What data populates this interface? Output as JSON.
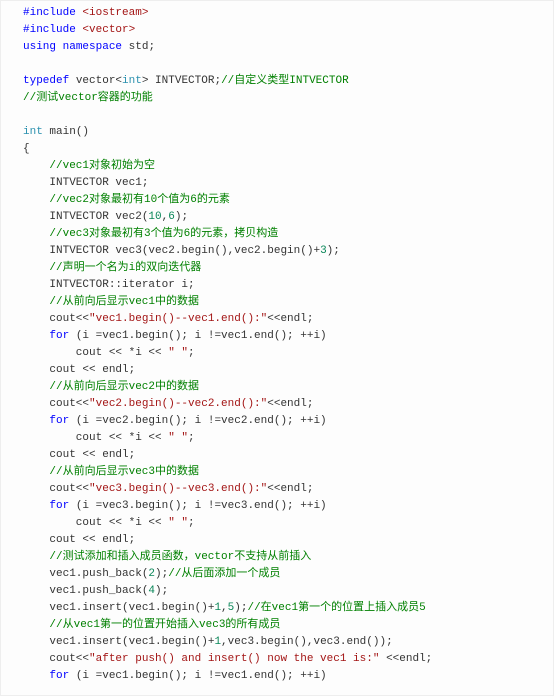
{
  "code": {
    "lines": [
      [
        {
          "c": "kw",
          "t": "#include"
        },
        {
          "c": "",
          "t": " "
        },
        {
          "c": "str",
          "t": "<iostream>"
        }
      ],
      [
        {
          "c": "kw",
          "t": "#include"
        },
        {
          "c": "",
          "t": " "
        },
        {
          "c": "str",
          "t": "<vector>"
        }
      ],
      [
        {
          "c": "kw",
          "t": "using"
        },
        {
          "c": "",
          "t": " "
        },
        {
          "c": "kw",
          "t": "namespace"
        },
        {
          "c": "",
          "t": " std;"
        }
      ],
      [
        {
          "c": "",
          "t": ""
        }
      ],
      [
        {
          "c": "kw",
          "t": "typedef"
        },
        {
          "c": "",
          "t": " vector<"
        },
        {
          "c": "type",
          "t": "int"
        },
        {
          "c": "",
          "t": "> INTVECTOR;"
        },
        {
          "c": "cmt",
          "t": "//自定义类型INTVECTOR"
        }
      ],
      [
        {
          "c": "cmt",
          "t": "//测试vector容器的功能"
        }
      ],
      [
        {
          "c": "",
          "t": ""
        }
      ],
      [
        {
          "c": "type",
          "t": "int"
        },
        {
          "c": "",
          "t": " main()"
        }
      ],
      [
        {
          "c": "",
          "t": "{"
        }
      ],
      [
        {
          "c": "",
          "t": "    "
        },
        {
          "c": "cmt",
          "t": "//vec1对象初始为空"
        }
      ],
      [
        {
          "c": "",
          "t": "    INTVECTOR vec1;"
        }
      ],
      [
        {
          "c": "",
          "t": "    "
        },
        {
          "c": "cmt",
          "t": "//vec2对象最初有10个值为6的元素"
        }
      ],
      [
        {
          "c": "",
          "t": "    INTVECTOR vec2("
        },
        {
          "c": "num",
          "t": "10"
        },
        {
          "c": "",
          "t": ","
        },
        {
          "c": "num",
          "t": "6"
        },
        {
          "c": "",
          "t": ");"
        }
      ],
      [
        {
          "c": "",
          "t": "    "
        },
        {
          "c": "cmt",
          "t": "//vec3对象最初有3个值为6的元素，拷贝构造"
        }
      ],
      [
        {
          "c": "",
          "t": "    INTVECTOR "
        },
        {
          "c": "ident",
          "t": "vec3"
        },
        {
          "c": "",
          "t": "(vec2.begin(),vec2.begin()+"
        },
        {
          "c": "num",
          "t": "3"
        },
        {
          "c": "",
          "t": ");"
        }
      ],
      [
        {
          "c": "",
          "t": "    "
        },
        {
          "c": "cmt",
          "t": "//声明一个名为i的双向迭代器"
        }
      ],
      [
        {
          "c": "",
          "t": "    INTVECTOR::iterator i;"
        }
      ],
      [
        {
          "c": "",
          "t": "    "
        },
        {
          "c": "cmt",
          "t": "//从前向后显示vec1中的数据"
        }
      ],
      [
        {
          "c": "",
          "t": "    cout<<"
        },
        {
          "c": "str",
          "t": "\"vec1.begin()--vec1.end():\""
        },
        {
          "c": "",
          "t": "<<endl;"
        }
      ],
      [
        {
          "c": "",
          "t": "    "
        },
        {
          "c": "kw",
          "t": "for"
        },
        {
          "c": "",
          "t": " (i =vec1.begin(); i !=vec1.end(); ++i)"
        }
      ],
      [
        {
          "c": "",
          "t": "        cout << *i << "
        },
        {
          "c": "str",
          "t": "\" \""
        },
        {
          "c": "",
          "t": ";"
        }
      ],
      [
        {
          "c": "",
          "t": "    cout << endl;"
        }
      ],
      [
        {
          "c": "",
          "t": "    "
        },
        {
          "c": "cmt",
          "t": "//从前向后显示vec2中的数据"
        }
      ],
      [
        {
          "c": "",
          "t": "    cout<<"
        },
        {
          "c": "str",
          "t": "\"vec2.begin()--vec2.end():\""
        },
        {
          "c": "",
          "t": "<<endl;"
        }
      ],
      [
        {
          "c": "",
          "t": "    "
        },
        {
          "c": "kw",
          "t": "for"
        },
        {
          "c": "",
          "t": " (i =vec2.begin(); i !=vec2.end(); ++i)"
        }
      ],
      [
        {
          "c": "",
          "t": "        cout << *i << "
        },
        {
          "c": "str",
          "t": "\" \""
        },
        {
          "c": "",
          "t": ";"
        }
      ],
      [
        {
          "c": "",
          "t": "    cout << endl;"
        }
      ],
      [
        {
          "c": "",
          "t": "    "
        },
        {
          "c": "cmt",
          "t": "//从前向后显示vec3中的数据"
        }
      ],
      [
        {
          "c": "",
          "t": "    cout<<"
        },
        {
          "c": "str",
          "t": "\"vec3.begin()--vec3.end():\""
        },
        {
          "c": "",
          "t": "<<endl;"
        }
      ],
      [
        {
          "c": "",
          "t": "    "
        },
        {
          "c": "kw",
          "t": "for"
        },
        {
          "c": "",
          "t": " (i =vec3.begin(); i !=vec3.end(); ++i)"
        }
      ],
      [
        {
          "c": "",
          "t": "        cout << *i << "
        },
        {
          "c": "str",
          "t": "\" \""
        },
        {
          "c": "",
          "t": ";"
        }
      ],
      [
        {
          "c": "",
          "t": "    cout << endl;"
        }
      ],
      [
        {
          "c": "",
          "t": "    "
        },
        {
          "c": "cmt",
          "t": "//测试添加和插入成员函数，vector不支持从前插入"
        }
      ],
      [
        {
          "c": "",
          "t": "    vec1.push_back("
        },
        {
          "c": "num",
          "t": "2"
        },
        {
          "c": "",
          "t": ");"
        },
        {
          "c": "cmt",
          "t": "//从后面添加一个成员"
        }
      ],
      [
        {
          "c": "",
          "t": "    vec1.push_back("
        },
        {
          "c": "num",
          "t": "4"
        },
        {
          "c": "",
          "t": ");"
        }
      ],
      [
        {
          "c": "",
          "t": "    vec1.insert(vec1.begin()+"
        },
        {
          "c": "num",
          "t": "1"
        },
        {
          "c": "",
          "t": ","
        },
        {
          "c": "num",
          "t": "5"
        },
        {
          "c": "",
          "t": ");"
        },
        {
          "c": "cmt",
          "t": "//在vec1第一个的位置上插入成员5"
        }
      ],
      [
        {
          "c": "",
          "t": "    "
        },
        {
          "c": "cmt",
          "t": "//从vec1第一的位置开始插入vec3的所有成员"
        }
      ],
      [
        {
          "c": "",
          "t": "    vec1.insert(vec1.begin()+"
        },
        {
          "c": "num",
          "t": "1"
        },
        {
          "c": "",
          "t": ",vec3.begin(),vec3.end());"
        }
      ],
      [
        {
          "c": "",
          "t": "    cout<<"
        },
        {
          "c": "str",
          "t": "\"after push() and insert() now the vec1 is:\""
        },
        {
          "c": "",
          "t": " <<endl;"
        }
      ],
      [
        {
          "c": "",
          "t": "    "
        },
        {
          "c": "kw",
          "t": "for"
        },
        {
          "c": "",
          "t": " (i =vec1.begin(); i !=vec1.end(); ++i)"
        }
      ]
    ]
  }
}
